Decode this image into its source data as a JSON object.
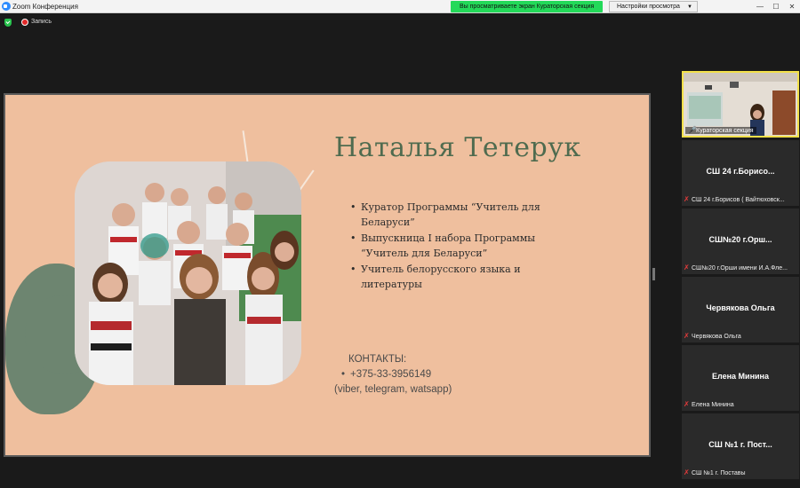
{
  "window": {
    "title": "Zoom Конференция",
    "share_banner": "Вы просматриваете экран Кураторская секция",
    "view_options": "Настройки просмотра",
    "recording_label": "Запись"
  },
  "slide": {
    "title": "Наталья Тетерук",
    "bullets": [
      "Куратор Программы “Учитель для Беларуси”",
      "Выпускница I набора Программы “Учитель для Беларуси”",
      "Учитель белорусского языка и литературы"
    ],
    "contacts_heading": "КОНТАКТЫ:",
    "phone": "+375-33-3956149",
    "messengers": "(viber, telegram, watsapp)"
  },
  "gallery": {
    "active_label": "Кураторская секция",
    "tiles": [
      {
        "name": "СШ 24 г.Борисо...",
        "label": "СШ 24 г.Борисов ( Вайтюховск..."
      },
      {
        "name": "СШ№20 г.Орш...",
        "label": "СШ№20 г.Орши имени И.А.Фле..."
      },
      {
        "name": "Червякова Ольга",
        "label": "Червякова Ольга"
      },
      {
        "name": "Елена Минина",
        "label": "Елена Минина"
      },
      {
        "name": "СШ №1 г. Пост...",
        "label": "СШ №1 г. Поставы"
      }
    ]
  },
  "colors": {
    "slide_bg": "#efbf9e",
    "title_green": "#4f6b4f",
    "banner_green": "#23d959",
    "active_border": "#f2e04a"
  }
}
